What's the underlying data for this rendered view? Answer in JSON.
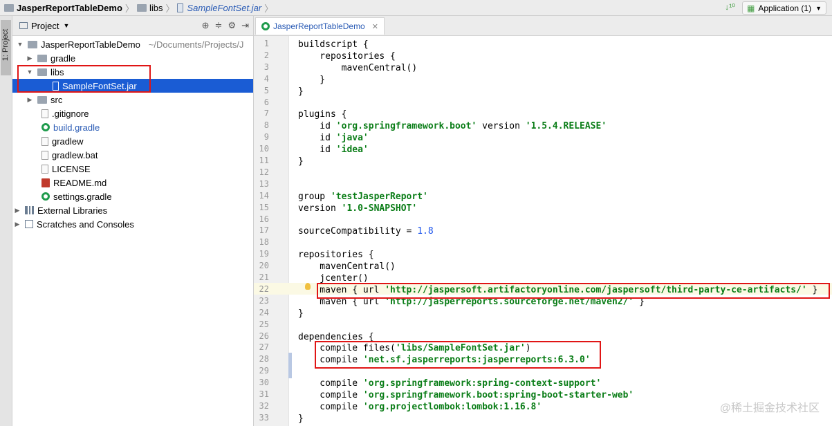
{
  "breadcrumb": {
    "project": "JasperReportTableDemo",
    "folder": "libs",
    "file": "SampleFontSet.jar"
  },
  "run_config": {
    "label": "Application (1)"
  },
  "tool_window_tab": "1: Project",
  "project_pane": {
    "title": "Project",
    "tree": [
      {
        "label": "JasperReportTableDemo",
        "path": "~/Documents/Projects/J",
        "icon": "project-folder-icon"
      },
      {
        "label": "gradle",
        "icon": "folder-icon"
      },
      {
        "label": "libs",
        "icon": "folder-icon"
      },
      {
        "label": "SampleFontSet.jar",
        "icon": "jar-icon"
      },
      {
        "label": "src",
        "icon": "folder-icon"
      },
      {
        "label": ".gitignore",
        "icon": "file-icon"
      },
      {
        "label": "build.gradle",
        "icon": "gradle-icon"
      },
      {
        "label": "gradlew",
        "icon": "file-icon"
      },
      {
        "label": "gradlew.bat",
        "icon": "file-icon"
      },
      {
        "label": "LICENSE",
        "icon": "file-icon"
      },
      {
        "label": "README.md",
        "icon": "markdown-icon"
      },
      {
        "label": "settings.gradle",
        "icon": "gradle-icon"
      },
      {
        "label": "External Libraries",
        "icon": "libraries-icon"
      },
      {
        "label": "Scratches and Consoles",
        "icon": "scratches-icon"
      }
    ]
  },
  "editor": {
    "tab_label": "JasperReportTableDemo",
    "lines": [
      {
        "n": "1",
        "code": "buildscript {"
      },
      {
        "n": "2",
        "code": "    repositories {"
      },
      {
        "n": "3",
        "code": "        mavenCentral()"
      },
      {
        "n": "4",
        "code": "    }"
      },
      {
        "n": "5",
        "code": "}"
      },
      {
        "n": "6",
        "code": ""
      },
      {
        "n": "7",
        "code": "plugins {"
      },
      {
        "n": "8",
        "code": "    id 'org.springframework.boot' version '1.5.4.RELEASE'"
      },
      {
        "n": "9",
        "code": "    id 'java'"
      },
      {
        "n": "10",
        "code": "    id 'idea'"
      },
      {
        "n": "11",
        "code": "}"
      },
      {
        "n": "12",
        "code": ""
      },
      {
        "n": "13",
        "code": ""
      },
      {
        "n": "14",
        "code": "group 'testJasperReport'"
      },
      {
        "n": "15",
        "code": "version '1.0-SNAPSHOT'"
      },
      {
        "n": "16",
        "code": ""
      },
      {
        "n": "17",
        "code": "sourceCompatibility = 1.8"
      },
      {
        "n": "18",
        "code": ""
      },
      {
        "n": "19",
        "code": "repositories {"
      },
      {
        "n": "20",
        "code": "    mavenCentral()"
      },
      {
        "n": "21",
        "code": "    jcenter()"
      },
      {
        "n": "22",
        "code": "    maven { url 'http://jaspersoft.artifactoryonline.com/jaspersoft/third-party-ce-artifacts/' }"
      },
      {
        "n": "23",
        "code": "    maven { url 'http://jasperreports.sourceforge.net/maven2/' }"
      },
      {
        "n": "24",
        "code": "}"
      },
      {
        "n": "25",
        "code": ""
      },
      {
        "n": "26",
        "code": "dependencies {"
      },
      {
        "n": "27",
        "code": "    compile files('libs/SampleFontSet.jar')"
      },
      {
        "n": "28",
        "code": "    compile 'net.sf.jasperreports:jasperreports:6.3.0'"
      },
      {
        "n": "29",
        "code": ""
      },
      {
        "n": "30",
        "code": "    compile 'org.springframework:spring-context-support'"
      },
      {
        "n": "31",
        "code": "    compile 'org.springframework.boot:spring-boot-starter-web'"
      },
      {
        "n": "32",
        "code": "    compile 'org.projectlombok:lombok:1.16.8'"
      },
      {
        "n": "33",
        "code": "}"
      }
    ]
  },
  "watermark": "@稀土掘金技术社区",
  "colors": {
    "selection": "#1a5cd4",
    "annotation": "#e01515",
    "string": "#0a7d17",
    "number": "#1750eb"
  }
}
